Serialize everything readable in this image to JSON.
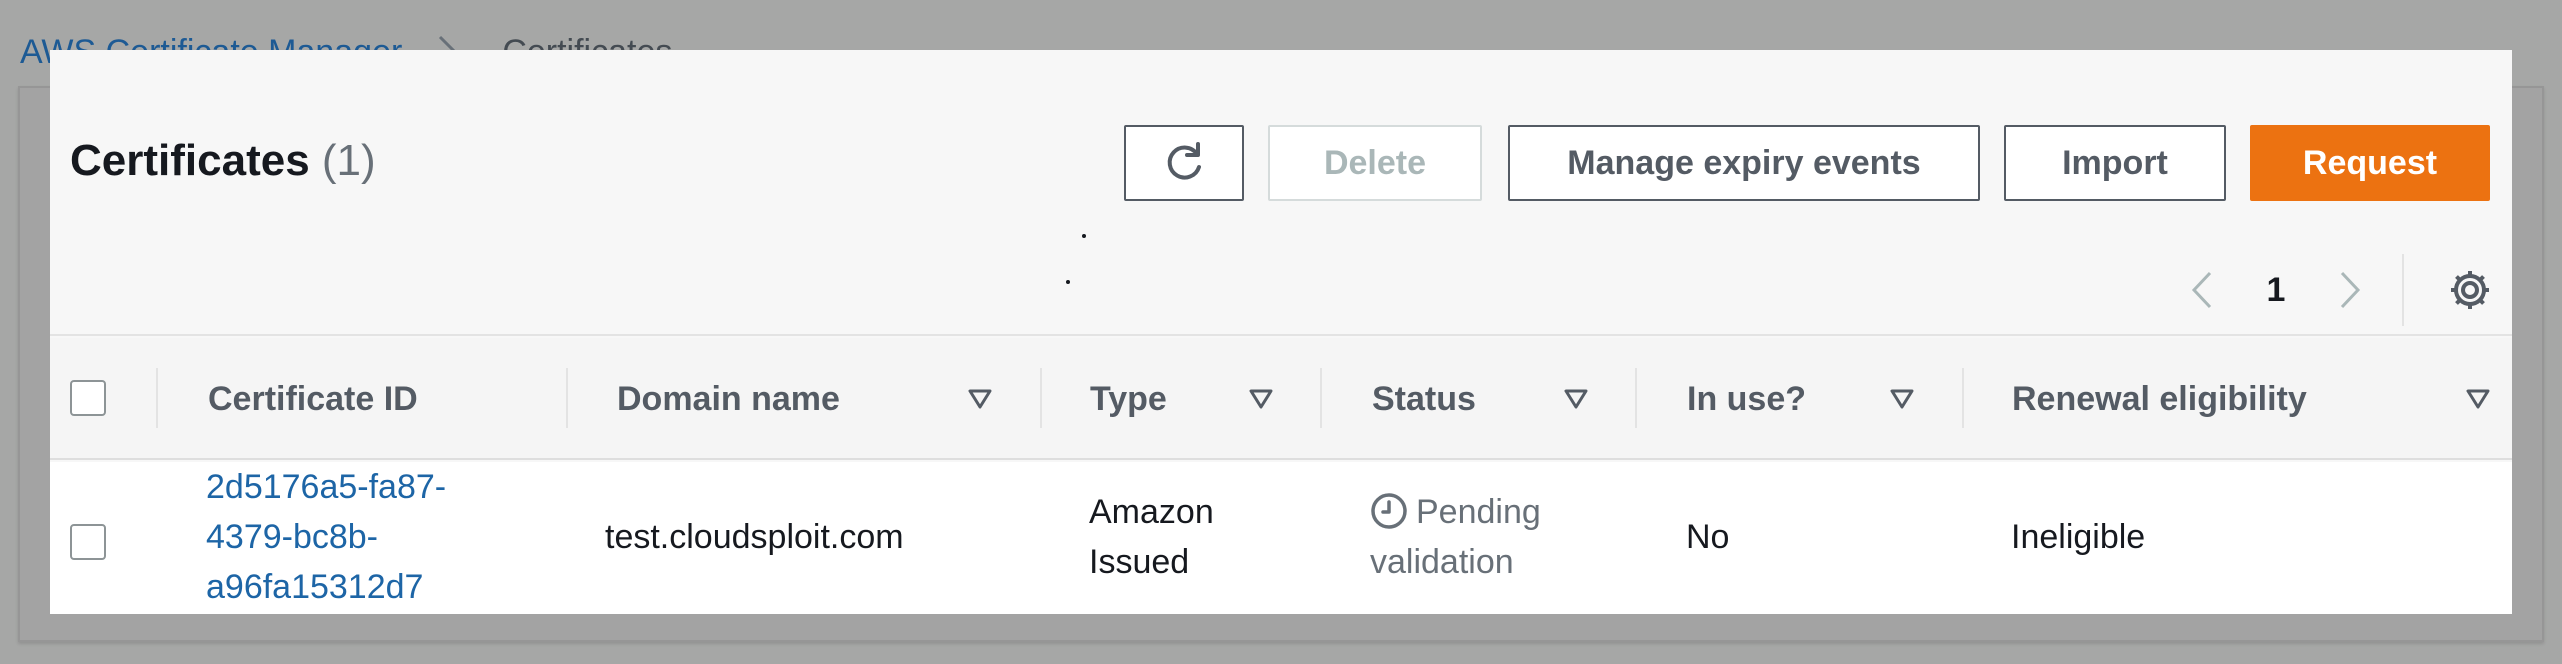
{
  "breadcrumb": {
    "service": "AWS Certificate Manager",
    "current": "Certificates"
  },
  "header": {
    "title": "Certificates",
    "count": "(1)"
  },
  "toolbar": {
    "delete_label": "Delete",
    "expiry_label": "Manage expiry events",
    "import_label": "Import",
    "request_label": "Request"
  },
  "pagination": {
    "current_page": "1"
  },
  "table": {
    "columns": [
      {
        "label": "Certificate ID",
        "sortable": false
      },
      {
        "label": "Domain name",
        "sortable": true
      },
      {
        "label": "Type",
        "sortable": true
      },
      {
        "label": "Status",
        "sortable": true
      },
      {
        "label": "In use?",
        "sortable": true
      },
      {
        "label": "Renewal eligibility",
        "sortable": true
      }
    ],
    "rows": [
      {
        "certificate_id_lines": [
          "2d5176a5-fa87-",
          "4379-bc8b-",
          "a96fa15312d7"
        ],
        "domain_name": "test.cloudsploit.com",
        "type_lines": [
          "Amazon",
          "Issued"
        ],
        "status_lines": [
          "Pending",
          "validation"
        ],
        "in_use": "No",
        "renewal_eligibility": "Ineligible"
      }
    ]
  },
  "colors": {
    "primary_button": "#ec7211",
    "link": "#1d65a6",
    "overlay": "#a6a7a6"
  },
  "icons": [
    "chevron-right-icon",
    "refresh-icon",
    "chevron-left-icon",
    "settings-gear-icon",
    "sort-caret-icon",
    "clock-icon"
  ]
}
